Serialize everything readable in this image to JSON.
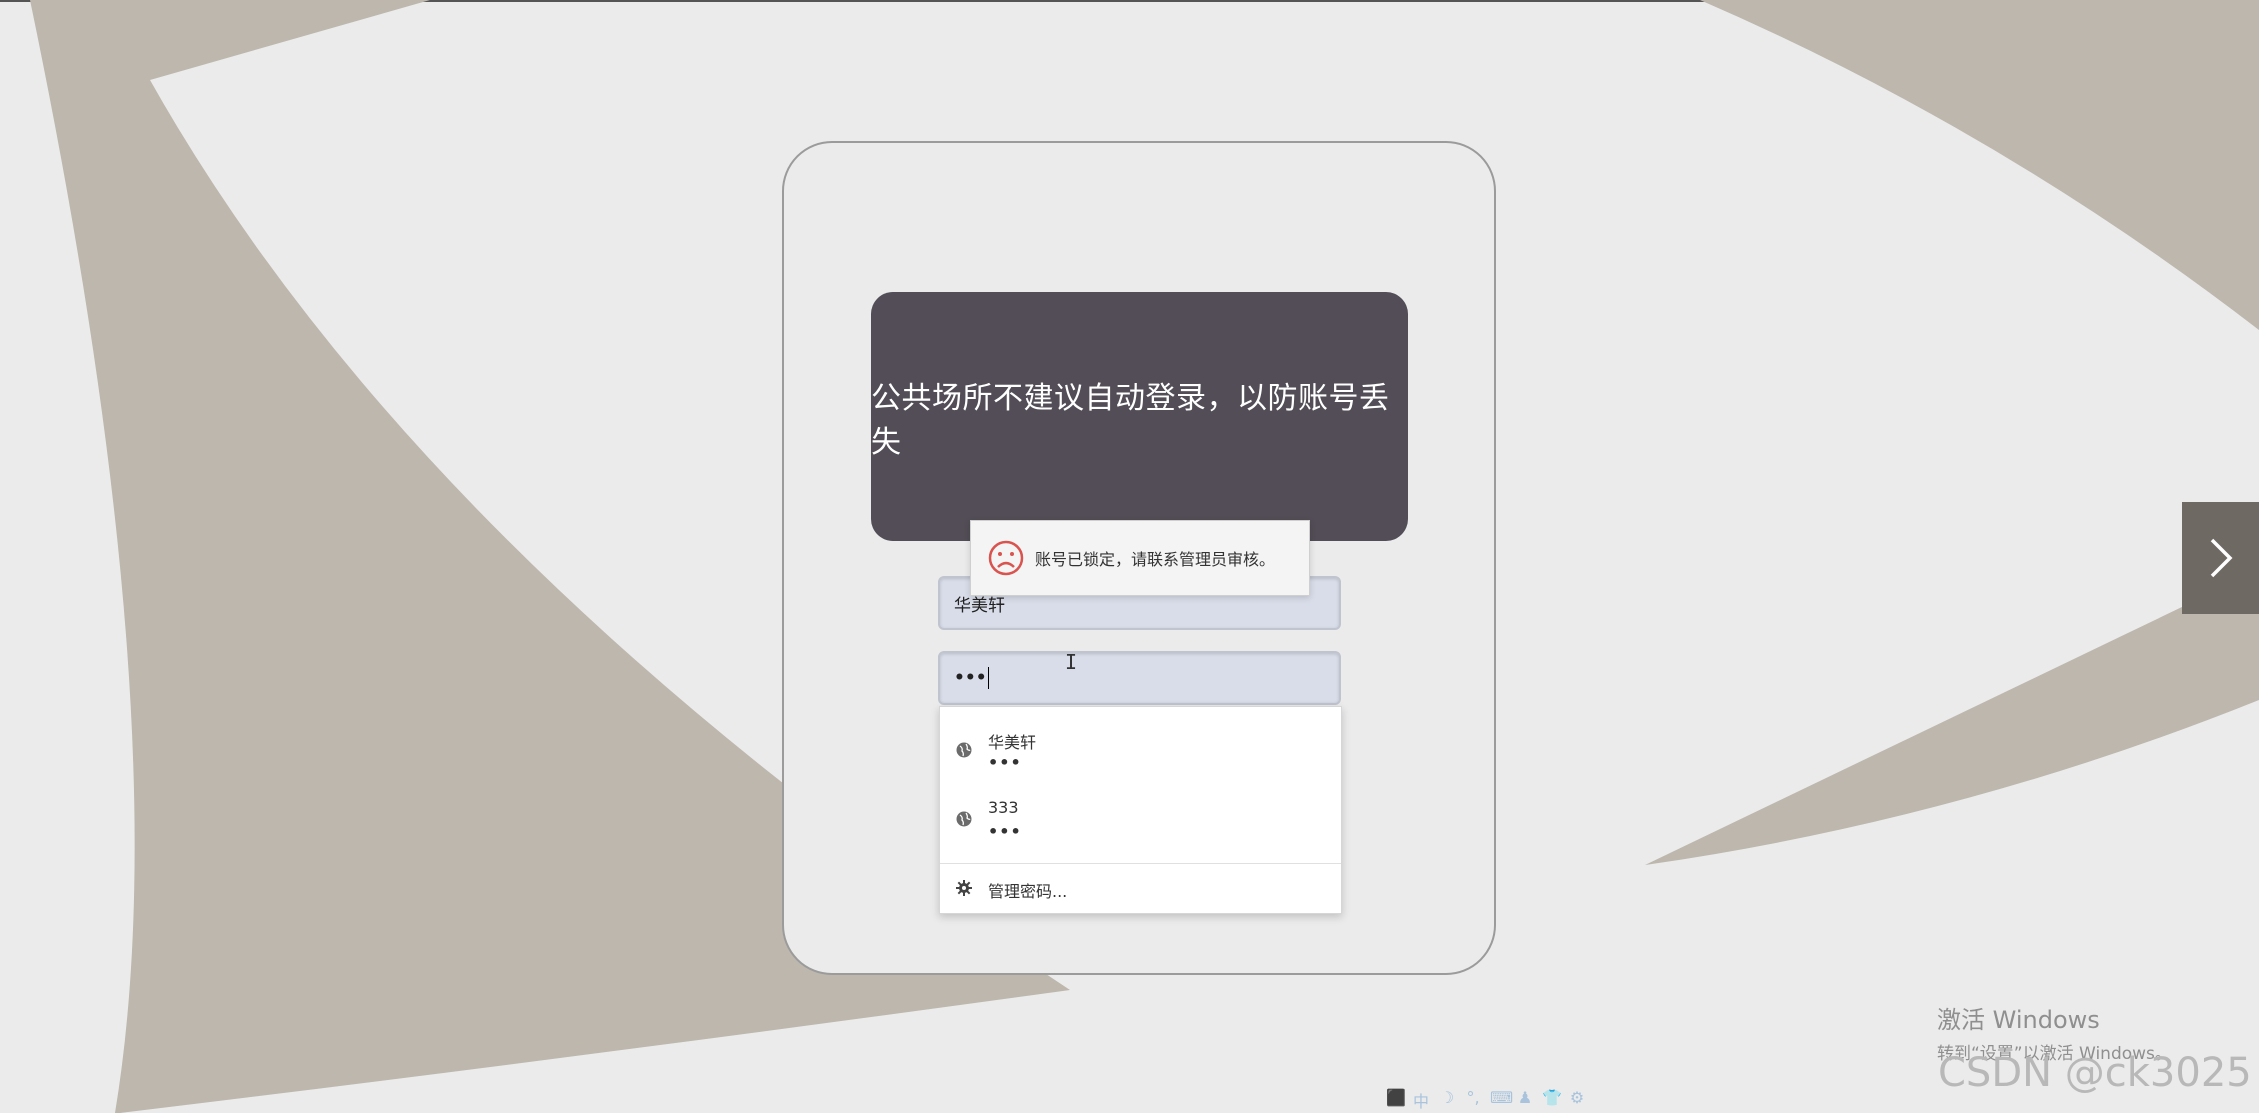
{
  "banner": {
    "text": "公共场所不建议自动登录，以防账号丢失"
  },
  "toast": {
    "message": "账号已锁定，请联系管理员审核。",
    "icon": "sad-face-icon"
  },
  "form": {
    "username_value": "华美轩",
    "password_value": "•••"
  },
  "autofill": {
    "entries": [
      {
        "username": "华美轩",
        "password_mask": "•••",
        "icon": "globe-icon"
      },
      {
        "username": "333",
        "password_mask": "•••",
        "icon": "globe-icon"
      }
    ],
    "manage_label": "管理密码...",
    "manage_icon": "gear-icon"
  },
  "next_button": {
    "icon": "chevron-right-icon"
  },
  "windows_activation": {
    "title": "激活 Windows",
    "subtitle": "转到“设置”以激活 Windows。"
  },
  "watermark": "CSDN @ck3025",
  "ime_toolbar": {
    "items": [
      "中",
      "☽",
      "°,",
      "⌨",
      "♟",
      "👕",
      "⚙"
    ]
  },
  "colors": {
    "background": "#ebebeb",
    "shape": "#bdb7ad",
    "banner": "#524d56",
    "input": "#d8dde9",
    "next_button": "#6e6a63"
  }
}
